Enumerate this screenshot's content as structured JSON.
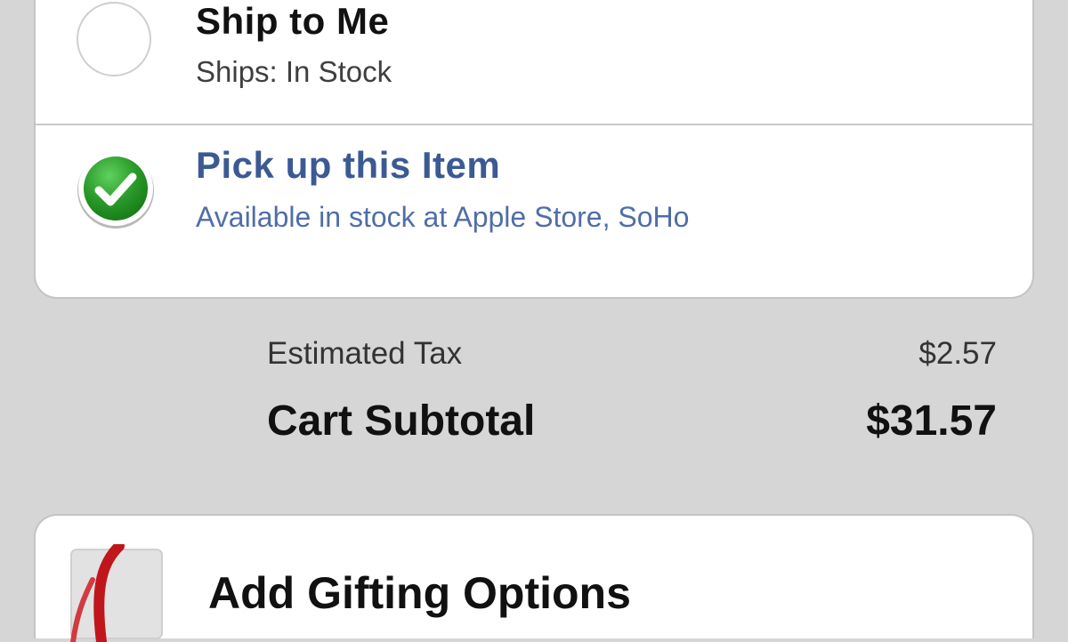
{
  "delivery_options": {
    "ship": {
      "title": "Ship to Me",
      "subtitle": "Ships: In Stock",
      "selected": false
    },
    "pickup": {
      "title": "Pick up this Item",
      "subtitle": "Available in stock at Apple Store, SoHo",
      "selected": true
    }
  },
  "totals": {
    "tax_label": "Estimated Tax",
    "tax_value": "$2.57",
    "subtotal_label": "Cart Subtotal",
    "subtotal_value": "$31.57"
  },
  "gifting": {
    "label": "Add Gifting Options",
    "icon": "gift-icon"
  },
  "colors": {
    "accent_blue": "#3b5a94",
    "check_green": "#2a9a2a",
    "background": "#d6d6d6"
  }
}
